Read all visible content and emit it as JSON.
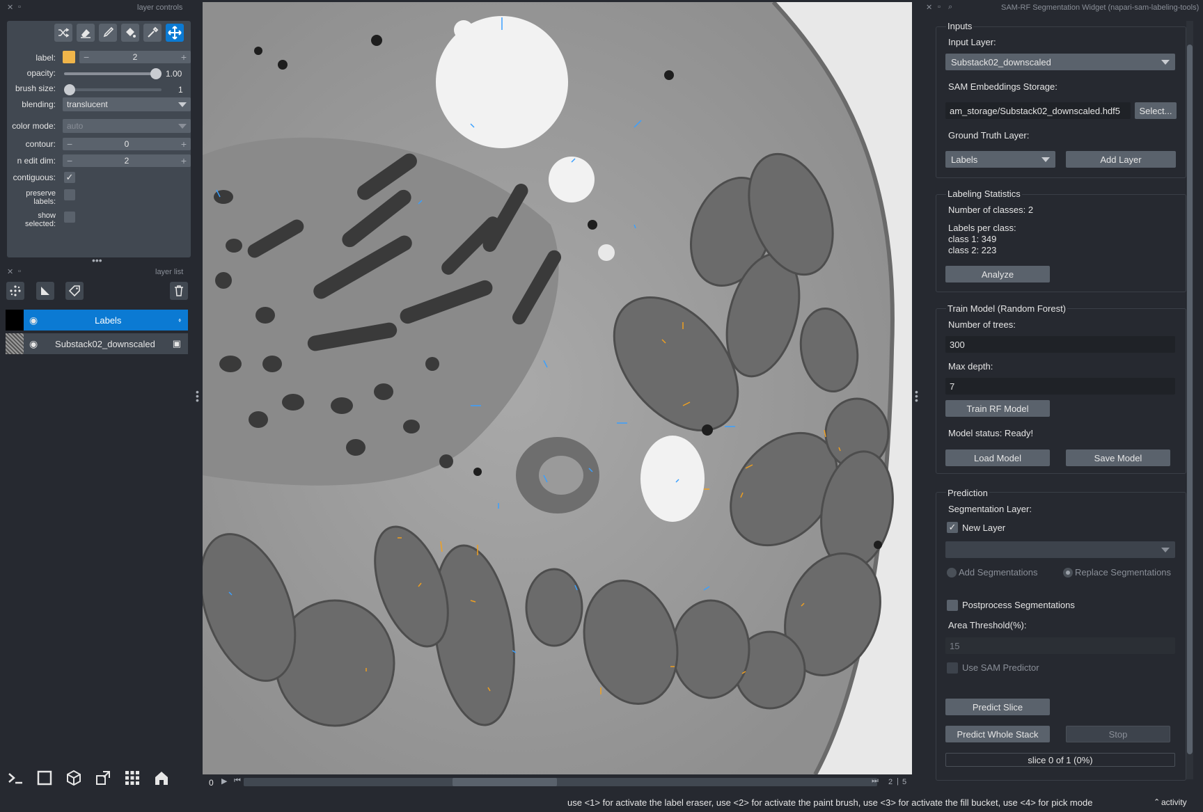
{
  "left_dock": {
    "controls_title": "layer controls",
    "list_title": "layer list",
    "label_label": "label:",
    "label_value": "2",
    "label_color": "#f0b54a",
    "opacity_label": "opacity:",
    "opacity_value": "1.00",
    "opacity_fraction": 1.0,
    "brush_label": "brush size:",
    "brush_value": "1",
    "brush_fraction": 0.0,
    "blending_label": "blending:",
    "blending_value": "translucent",
    "color_mode_label": "color mode:",
    "color_mode_value": "auto",
    "contour_label": "contour:",
    "contour_value": "0",
    "n_edit_dim_label": "n edit dim:",
    "n_edit_dim_value": "2",
    "contiguous_label": "contiguous:",
    "preserve_labels_label": "preserve\nlabels:",
    "show_selected_label": "show\nselected:",
    "layers": [
      {
        "name": "Labels",
        "selected": true
      },
      {
        "name": "Substack02_downscaled",
        "selected": false
      }
    ]
  },
  "viewer": {
    "slice_index": "0",
    "dim_a": "2",
    "dim_b": "5"
  },
  "widget": {
    "title": "SAM-RF Segmentation Widget (napari-sam-labeling-tools)",
    "inputs": {
      "title": "Inputs",
      "input_layer_label": "Input Layer:",
      "input_layer_value": "Substack02_downscaled",
      "embeddings_label": "SAM Embeddings Storage:",
      "embeddings_value": "am_storage/Substack02_downscaled.hdf5",
      "select_button": "Select...",
      "gt_label": "Ground Truth Layer:",
      "gt_value": "Labels",
      "add_layer_button": "Add Layer"
    },
    "stats": {
      "title": "Labeling Statistics",
      "num_classes": "Number of classes: 2",
      "labels_per_class": "Labels per class:",
      "class1": "class 1: 349",
      "class2": "class 2: 223",
      "analyze_button": "Analyze"
    },
    "train": {
      "title": "Train Model (Random Forest)",
      "trees_label": "Number of trees:",
      "trees_value": "300",
      "depth_label": "Max depth:",
      "depth_value": "7",
      "train_button": "Train RF Model",
      "status": "Model status: Ready!",
      "load_button": "Load Model",
      "save_button": "Save Model"
    },
    "prediction": {
      "title": "Prediction",
      "seg_layer_label": "Segmentation Layer:",
      "new_layer_label": "New Layer",
      "add_seg_label": "Add Segmentations",
      "replace_seg_label": "Replace Segmentations",
      "postprocess_label": "Postprocess Segmentations",
      "area_label": "Area Threshold(%):",
      "area_value": "15",
      "use_sam_label": "Use SAM Predictor",
      "predict_slice_button": "Predict Slice",
      "predict_stack_button": "Predict Whole Stack",
      "stop_button": "Stop",
      "progress_text": "slice 0 of 1 (0%)",
      "progress_fraction": 0.0
    }
  },
  "status_bar": {
    "hint": "use <1> for activate the label eraser, use <2> for activate the paint brush, use <3> for activate the fill bucket, use <4> for pick mode",
    "activity": "activity"
  }
}
